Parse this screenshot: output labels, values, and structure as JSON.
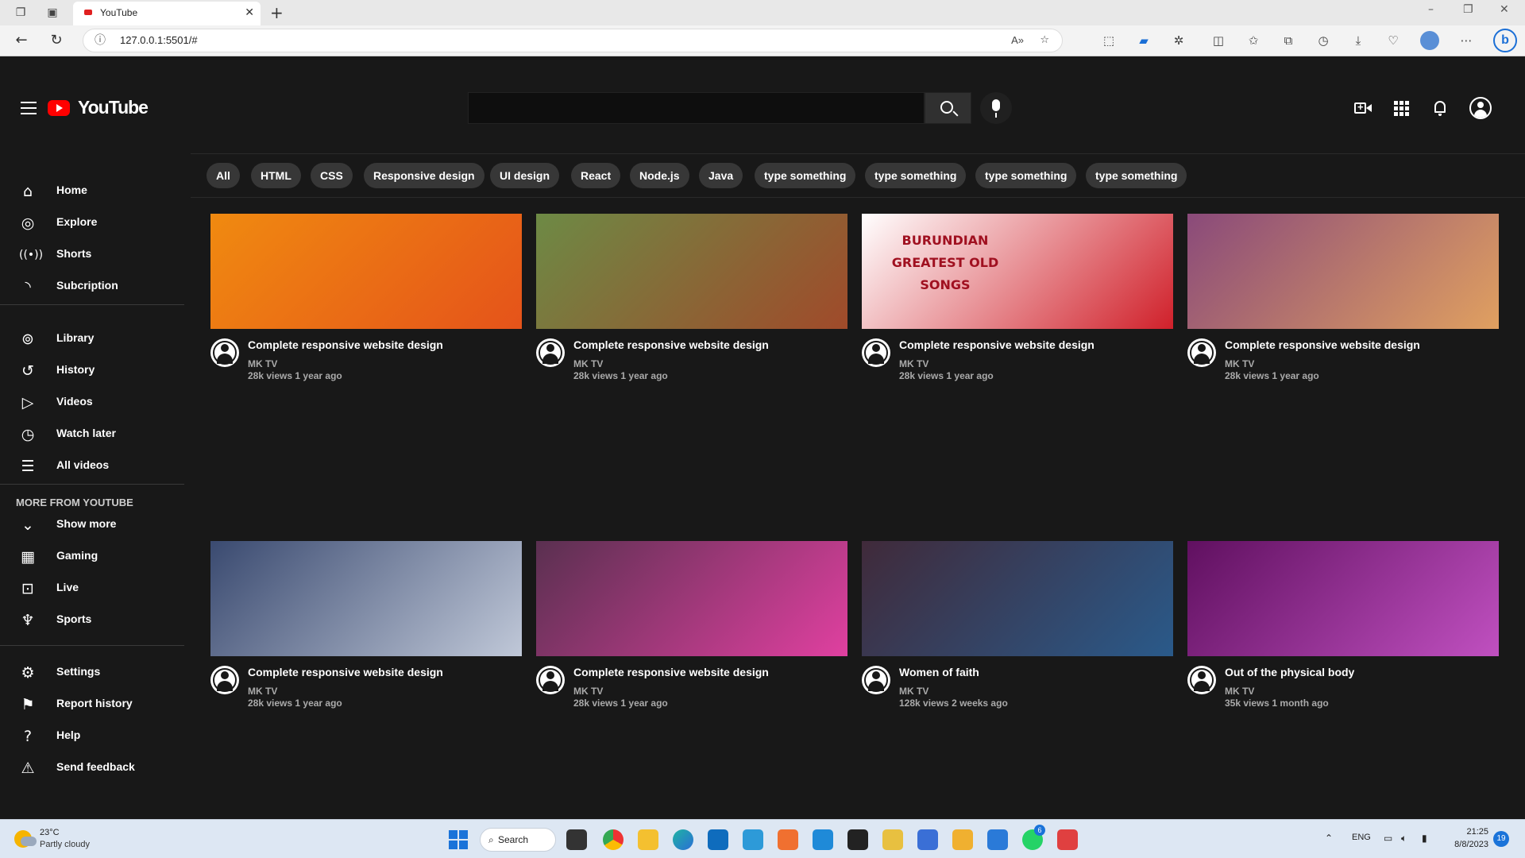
{
  "browser": {
    "tab_title": "YouTube",
    "address": "127.0.0.1:5501/#",
    "read_aloud": "A»"
  },
  "header": {
    "logo_text": "YouTube",
    "search_value": ""
  },
  "sidebar": {
    "group1": [
      {
        "label": "Home",
        "icon": "home-icon"
      },
      {
        "label": "Explore",
        "icon": "compass-icon"
      },
      {
        "label": "Shorts",
        "icon": "shorts-icon"
      },
      {
        "label": "Subcription",
        "icon": "rss-icon"
      }
    ],
    "group2": [
      {
        "label": "Library",
        "icon": "library-icon"
      },
      {
        "label": "History",
        "icon": "history-icon"
      },
      {
        "label": "Videos",
        "icon": "videos-icon"
      },
      {
        "label": "Watch later",
        "icon": "clock-icon"
      },
      {
        "label": "All videos",
        "icon": "playlist-icon"
      }
    ],
    "more_title": "MORE FROM YOUTUBE",
    "group3": [
      {
        "label": "Show more",
        "icon": "chevron-down-icon"
      },
      {
        "label": "Gaming",
        "icon": "gaming-icon"
      },
      {
        "label": "Live",
        "icon": "live-icon"
      },
      {
        "label": "Sports",
        "icon": "trophy-icon"
      }
    ],
    "group4": [
      {
        "label": "Settings",
        "icon": "gear-icon"
      },
      {
        "label": "Report history",
        "icon": "flag-icon"
      },
      {
        "label": "Help",
        "icon": "help-icon"
      },
      {
        "label": "Send feedback",
        "icon": "feedback-icon"
      }
    ]
  },
  "chips": [
    "All",
    "HTML",
    "CSS",
    "Responsive design",
    "UI design",
    "React",
    "Node.js",
    "Java",
    "type something",
    "type something",
    "type something",
    "type something"
  ],
  "videos": [
    {
      "title": "Complete responsive website design",
      "channel": "MK TV",
      "views": "28k views",
      "age": "1 year ago",
      "thumb_colors": [
        "#f08a10",
        "#e5531a"
      ]
    },
    {
      "title": "Complete responsive website design",
      "channel": "MK TV",
      "views": "28k views",
      "age": "1 year ago",
      "thumb_colors": [
        "#6d8a45",
        "#a04a2a"
      ]
    },
    {
      "title": "Complete responsive website design",
      "channel": "MK TV",
      "views": "28k views",
      "age": "1 year ago",
      "thumb_colors": [
        "#ffffff",
        "#d0202a"
      ],
      "thumb_text": "BURUNDIAN GREATEST OLD SONGS"
    },
    {
      "title": "Complete responsive website design",
      "channel": "MK TV",
      "views": "28k views",
      "age": "1 year ago",
      "thumb_colors": [
        "#8a4a7a",
        "#e0a060"
      ]
    },
    {
      "title": "Complete responsive website design",
      "channel": "MK TV",
      "views": "28k views",
      "age": "1 year ago",
      "thumb_colors": [
        "#3a4a70",
        "#c0c8d8"
      ]
    },
    {
      "title": "Complete responsive website design",
      "channel": "MK TV",
      "views": "28k views",
      "age": "1 year ago",
      "thumb_colors": [
        "#5a3050",
        "#e040a0"
      ]
    },
    {
      "title": "Women of faith",
      "channel": "MK TV",
      "views": "128k views",
      "age": "2 weeks ago",
      "thumb_colors": [
        "#402a3a",
        "#2a5a8a"
      ]
    },
    {
      "title": "Out of the physical body",
      "channel": "MK TV",
      "views": "35k views",
      "age": "1 month ago",
      "thumb_colors": [
        "#601060",
        "#c050c0"
      ]
    }
  ],
  "taskbar": {
    "temp": "23°C",
    "weather": "Partly cloudy",
    "search_label": "Search",
    "lang": "ENG",
    "time": "21:25",
    "date": "8/8/2023",
    "notifications": "19",
    "whatsapp_badge": "6"
  }
}
